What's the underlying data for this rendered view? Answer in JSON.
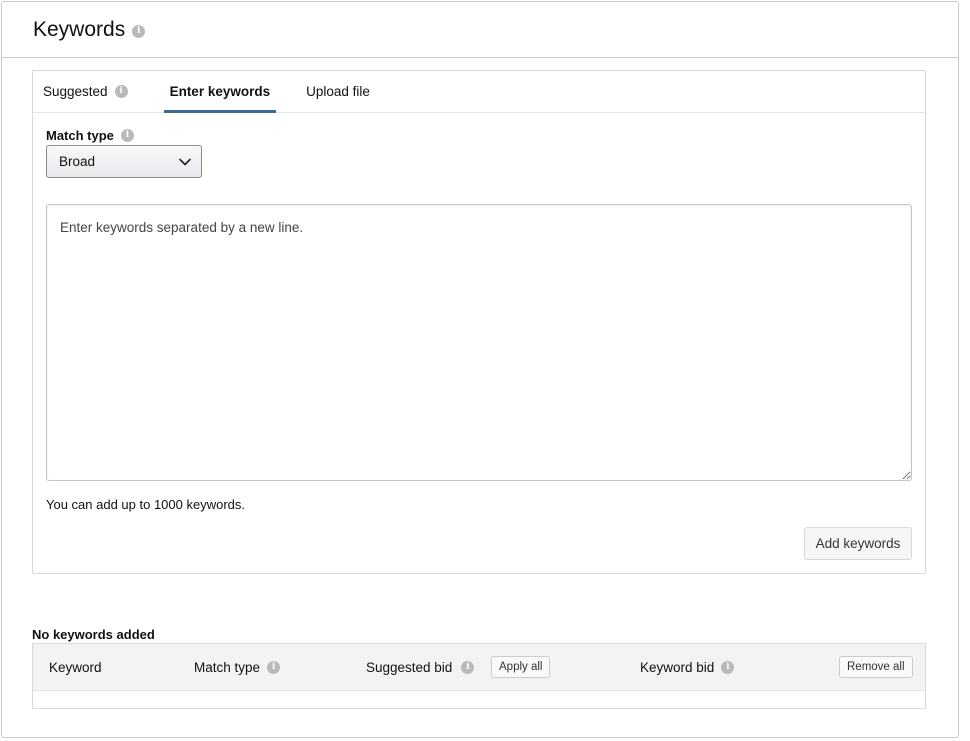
{
  "header": {
    "title": "Keywords"
  },
  "tabs": [
    {
      "label": "Suggested"
    },
    {
      "label": "Enter keywords"
    },
    {
      "label": "Upload file"
    }
  ],
  "match_type": {
    "label": "Match type",
    "selected": "Broad"
  },
  "keywords_input": {
    "placeholder": "Enter keywords separated by a new line.",
    "value": ""
  },
  "limit_note": "You can add up to 1000 keywords.",
  "add_button": "Add keywords",
  "added": {
    "empty_label": "No keywords added",
    "columns": {
      "keyword": "Keyword",
      "match_type": "Match type",
      "suggested_bid": "Suggested bid",
      "keyword_bid": "Keyword bid"
    },
    "apply_all": "Apply all",
    "remove_all": "Remove all"
  },
  "icons": {
    "info": "info-icon",
    "dropdown": "chevron-down-icon"
  },
  "colors": {
    "active_tab_underline": "#386b95",
    "info_icon": "#b9b9b9",
    "border": "#c9c9c9"
  }
}
